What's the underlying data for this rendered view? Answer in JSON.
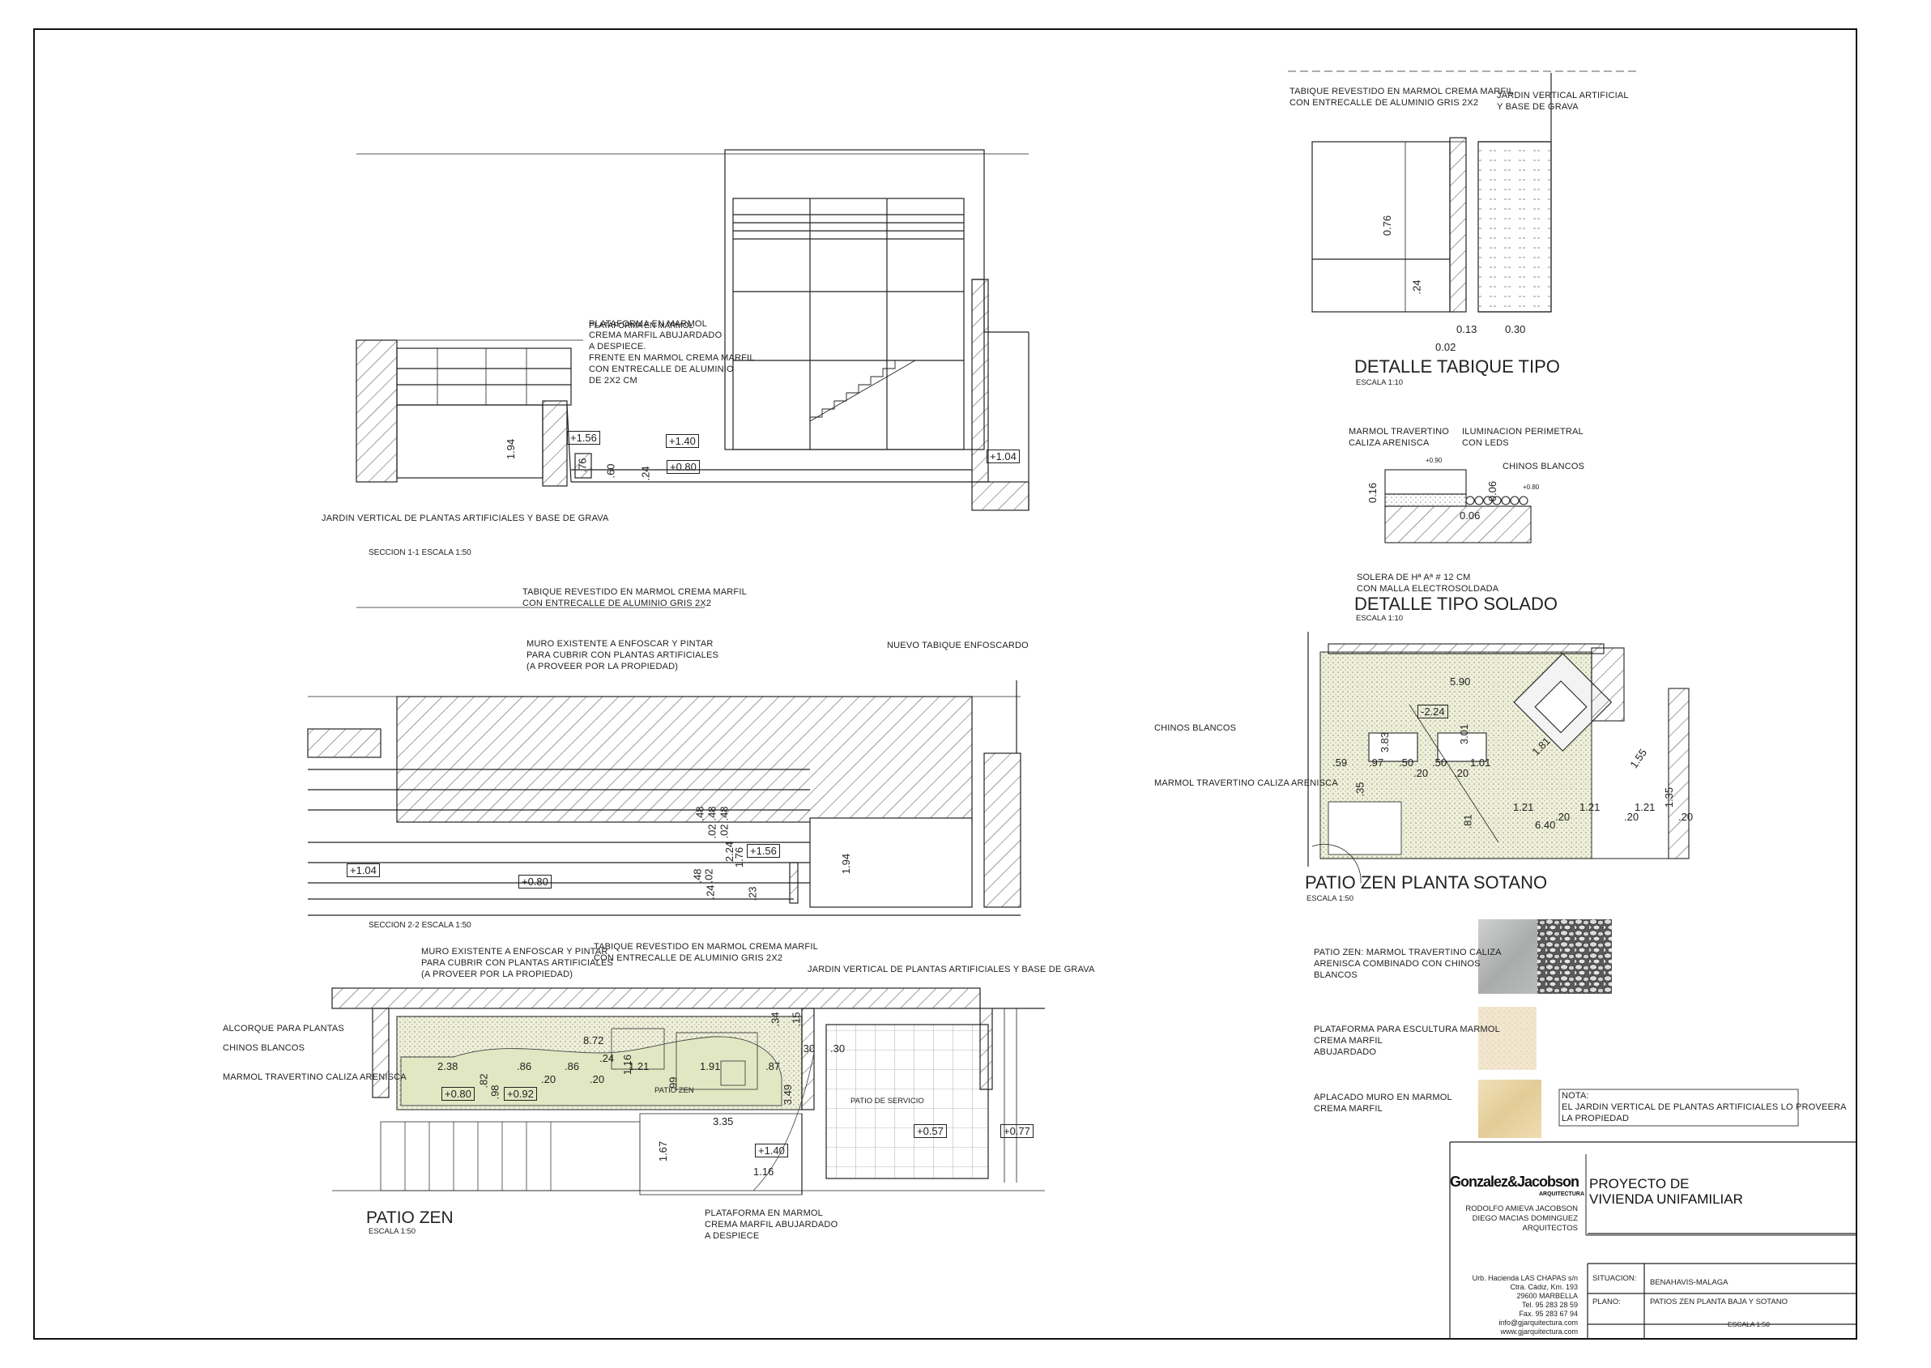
{
  "section_1_1": {
    "caption": "SECCION 1-1 ESCALA 1:50",
    "notes": {
      "plataforma": [
        "PLATAFORMA EN MARMOL",
        "CREMA MARFIL ABUJARDADO",
        "A DESPIECE.",
        "FRENTE EN MARMOL CREMA MARFIL",
        "CON ENTRECALLE DE ALUMINIO",
        "DE 2X2 CM"
      ],
      "jardin": "JARDIN VERTICAL DE PLANTAS ARTIFICIALES Y BASE DE GRAVA"
    },
    "levels": [
      "+1.56",
      "+1.40",
      "+0.80",
      "+1.04"
    ],
    "dims": [
      "1.94",
      ".76",
      ".60",
      ".24"
    ]
  },
  "section_2_2": {
    "caption": "SECCION 2-2 ESCALA 1:50",
    "notes": {
      "tabique": [
        "TABIQUE REVESTIDO EN MARMOL CREMA MARFIL",
        "CON ENTRECALLE DE ALUMINIO GRIS 2X2"
      ],
      "muro": [
        "MURO EXISTENTE A ENFOSCAR Y PINTAR",
        "PARA CUBRIR CON PLANTAS ARTIFICIALES",
        "(A PROVEER POR LA PROPIEDAD)"
      ],
      "nuevo": "NUEVO TABIQUE ENFOSCARDO"
    },
    "levels": [
      "+1.04",
      "+0.80",
      "+1.56"
    ],
    "dims": [
      ".48",
      ".48",
      ".48",
      ".02",
      ".02",
      "2.24",
      "1.76",
      ".48",
      ".02",
      ".24",
      ".23",
      "1.94"
    ]
  },
  "patio_zen": {
    "title": "PATIO ZEN",
    "scale": "ESCALA 1:50",
    "notes": {
      "muro": [
        "MURO EXISTENTE A ENFOSCAR Y PINTAR",
        "PARA CUBRIR CON PLANTAS ARTIFICIALES",
        "(A PROVEER POR LA PROPIEDAD)"
      ],
      "tabique": [
        "TABIQUE REVESTIDO EN MARMOL CREMA MARFIL",
        "CON ENTRECALLE DE ALUMINIO GRIS 2X2"
      ],
      "jardin": "JARDIN VERTICAL DE PLANTAS ARTIFICIALES Y BASE DE GRAVA",
      "alcorque": "ALCORQUE PARA PLANTAS",
      "chinos": "CHINOS BLANCOS",
      "marmol": "MARMOL TRAVERTINO CALIZA ARENISCA",
      "plataforma": [
        "PLATAFORMA EN MARMOL",
        "CREMA MARFIL ABUJARDADO",
        "A DESPIECE"
      ],
      "patio_label": "PATIO ZEN",
      "servicio": "PATIO DE SERVICIO"
    },
    "levels": [
      "+0.80",
      "+0.92",
      "+1.40",
      "+0.57",
      "+0.77"
    ],
    "dims": [
      "8.72",
      "2.38",
      ".82",
      ".98",
      ".86",
      ".86",
      ".20",
      ".24",
      "1.16",
      ".20",
      "1.21",
      "1.91",
      ".99",
      ".87",
      "3.49",
      ".34",
      ".15",
      ".30",
      ".30",
      "3.35",
      "1.67",
      "1.16"
    ]
  },
  "detalle_tabique": {
    "title": "DETALLE TABIQUE TIPO",
    "scale": "ESCALA 1:10",
    "notes": {
      "tabique": [
        "TABIQUE REVESTIDO EN MARMOL CREMA MARFIL",
        "CON ENTRECALLE DE ALUMINIO GRIS 2X2"
      ],
      "jardin": [
        "JARDIN VERTICAL ARTIFICIAL",
        "Y BASE DE GRAVA"
      ]
    },
    "dims": [
      "0.76",
      ".24",
      "0.13",
      "0.30",
      "0.02"
    ]
  },
  "detalle_solado": {
    "title": "DETALLE TIPO SOLADO",
    "scale": "ESCALA 1:10",
    "notes": {
      "marmol": [
        "MARMOL TRAVERTINO",
        "CALIZA ARENISCA"
      ],
      "iluminacion": [
        "ILUMINACION PERIMETRAL",
        "CON LEDS"
      ],
      "chinos": "CHINOS BLANCOS",
      "solera": [
        "SOLERA DE Hª Aª # 12 CM",
        "CON MALLA ELECTROSOLDADA"
      ]
    },
    "levels": [
      "+0.90",
      "+0.80"
    ],
    "dims": [
      "0.16",
      "0.06",
      "0.06"
    ]
  },
  "patio_sotano": {
    "title": "PATIO ZEN PLANTA SOTANO",
    "scale": "ESCALA 1:50",
    "notes": {
      "chinos": "CHINOS BLANCOS",
      "marmol": "MARMOL TRAVERTINO CALIZA ARENISCA"
    },
    "levels": [
      "-2.24"
    ],
    "dims": [
      "5.90",
      "3.83",
      "3.01",
      "1.81",
      "1.55",
      ".59",
      ".97",
      ".50",
      ".50",
      "1.01",
      ".35",
      ".20",
      ".20",
      "1.21",
      "1.21",
      "1.21",
      ".20",
      ".20",
      "1.35",
      ".20",
      "6.40",
      ".81"
    ]
  },
  "legend": [
    {
      "text": [
        "PATIO ZEN: MARMOL TRAVERTINO CALIZA",
        "ARENISCA COMBINADO CON CHINOS",
        "BLANCOS"
      ]
    },
    {
      "text": [
        "PLATAFORMA PARA ESCULTURA MARMOL",
        "CREMA MARFIL",
        "ABUJARDADO"
      ]
    },
    {
      "text": [
        "APLACADO MURO EN MARMOL",
        "CREMA MARFIL"
      ]
    }
  ],
  "nota": [
    "NOTA:",
    "EL JARDIN VERTICAL DE PLANTAS ARTIFICIALES LO PROVEERA",
    "LA PROPIEDAD"
  ],
  "title_block": {
    "logo": "Gonzalez&Jacobson",
    "logo_sub": "ARQUITECTURA",
    "project": [
      "PROYECTO DE",
      "VIVIENDA UNIFAMILIAR"
    ],
    "architects": [
      "RODOLFO AMIEVA JACOBSON",
      "DIEGO MACIAS DOMINGUEZ",
      "ARQUITECTOS"
    ],
    "address": [
      "Urb. Hacienda LAS CHAPAS s/n",
      "Ctra. Cádiz, Km. 193",
      "29600 MARBELLA",
      "Tel. 95 283 28 59",
      "Fax. 95 283 67 94",
      "info@gjarquitectura.com",
      "www.gjarquitectura.com"
    ],
    "situacion_label": "SITUACION:",
    "situacion_value": "BENAHAVIS-MALAGA",
    "plano_label": "PLANO:",
    "plano_value": "PATIOS ZEN PLANTA BAJA Y SOTANO",
    "escala_value": "ESCALA 1:50"
  }
}
